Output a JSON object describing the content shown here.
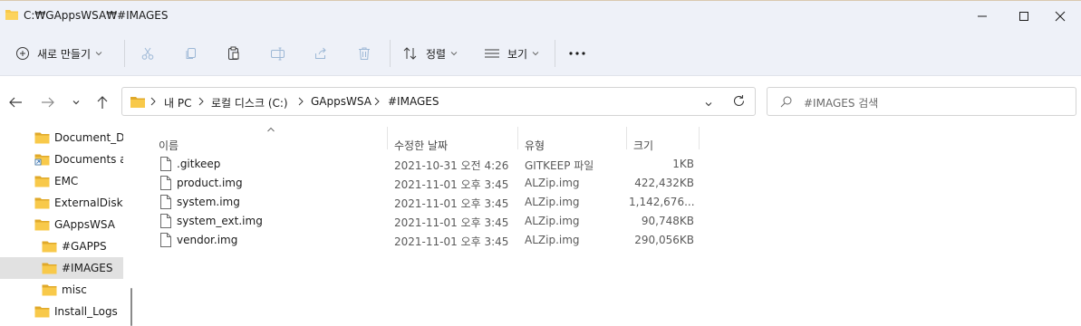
{
  "window": {
    "title": "C:₩GAppsWSA₩#IMAGES"
  },
  "toolbar": {
    "new_label": "새로 만들기",
    "sort_label": "정렬",
    "view_label": "보기",
    "more_label": "···",
    "icons": [
      "cut-icon",
      "copy-icon",
      "paste-icon",
      "rename-icon",
      "share-icon",
      "delete-icon"
    ]
  },
  "address": {
    "crumbs": [
      "내 PC",
      "로컬 디스크 (C:)",
      "GAppsWSA",
      "#IMAGES"
    ]
  },
  "search": {
    "placeholder": "#IMAGES 검색"
  },
  "navpane": {
    "items": [
      {
        "label": "Document_De",
        "type": "folder"
      },
      {
        "label": "Documents ar",
        "type": "shortcut"
      },
      {
        "label": "EMC",
        "type": "folder"
      },
      {
        "label": "ExternalDisk",
        "type": "folder"
      },
      {
        "label": "GAppsWSA",
        "type": "folder"
      },
      {
        "label": "#GAPPS",
        "type": "folder"
      },
      {
        "label": "#IMAGES",
        "type": "folder",
        "selected": true
      },
      {
        "label": "misc",
        "type": "folder"
      },
      {
        "label": "Install_Logs",
        "type": "folder"
      }
    ]
  },
  "columns": {
    "name": "이름",
    "date": "수정한 날짜",
    "type": "유형",
    "size": "크기"
  },
  "files": [
    {
      "name": ".gitkeep",
      "date": "2021-10-31 오전 4:26",
      "type": "GITKEEP 파일",
      "size": "1KB"
    },
    {
      "name": "product.img",
      "date": "2021-11-01 오후 3:45",
      "type": "ALZip.img",
      "size": "422,432KB"
    },
    {
      "name": "system.img",
      "date": "2021-11-01 오후 3:45",
      "type": "ALZip.img",
      "size": "1,142,676..."
    },
    {
      "name": "system_ext.img",
      "date": "2021-11-01 오후 3:45",
      "type": "ALZip.img",
      "size": "90,748KB"
    },
    {
      "name": "vendor.img",
      "date": "2021-11-01 오후 3:45",
      "type": "ALZip.img",
      "size": "290,056KB"
    }
  ],
  "colors": {
    "folder": "#f8c94a",
    "folder_dark": "#e0a92a",
    "selected": "#e1e1e1",
    "chrome": "#eef1f8"
  }
}
